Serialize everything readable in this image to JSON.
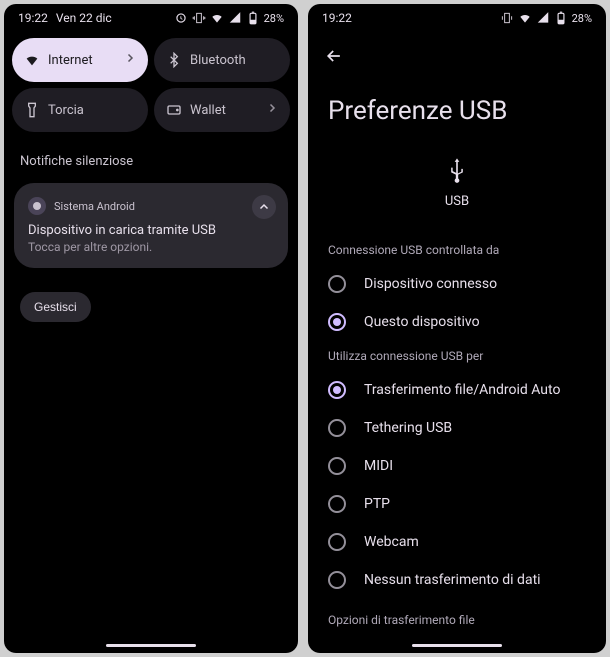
{
  "left": {
    "status": {
      "time": "19:22",
      "date": "Ven 22 dic",
      "battery": "28%"
    },
    "tiles": {
      "internet": {
        "label": "Internet"
      },
      "bluetooth": {
        "label": "Bluetooth"
      },
      "torch": {
        "label": "Torcia"
      },
      "wallet": {
        "label": "Wallet"
      }
    },
    "notif": {
      "header": "Notifiche silenziose",
      "app": "Sistema Android",
      "title": "Dispositivo in carica tramite USB",
      "sub": "Tocca per altre opzioni."
    },
    "manage": "Gestisci"
  },
  "right": {
    "status": {
      "time": "19:22",
      "battery": "28%"
    },
    "title": "Preferenze USB",
    "usbLabel": "USB",
    "section1": "Connessione USB controllata da",
    "radios1": {
      "connected": "Dispositivo connesso",
      "thisDevice": "Questo dispositivo"
    },
    "section2": "Utilizza connessione USB per",
    "radios2": {
      "fileTransfer": "Trasferimento file/Android Auto",
      "tethering": "Tethering USB",
      "midi": "MIDI",
      "ptp": "PTP",
      "webcam": "Webcam",
      "none": "Nessun trasferimento di dati"
    },
    "bottom": "Opzioni di trasferimento file"
  }
}
